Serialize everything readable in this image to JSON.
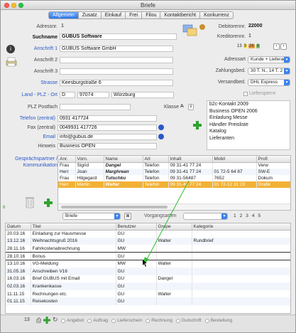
{
  "window": {
    "title": "Briefe"
  },
  "tabs": [
    "Allgemein",
    "Zusatz",
    "Einkauf",
    "Frei",
    "Filou",
    "Kontaktbericht",
    "Konkurrenz"
  ],
  "header": {
    "adressnr_label": "Adressnr.",
    "adressnr_value": "1",
    "suchname_label": "Suchname",
    "suchname_value": "GUBUS Software",
    "debitorennr_label": "Debitorennr.",
    "debitorennr_value": "22000",
    "kreditorennr_label": "Kreditorennr.",
    "kreditorennr_value": "1",
    "counters": [
      "13",
      "9",
      "26",
      "8"
    ]
  },
  "address": {
    "anschrift1_label": "Anschrift 1",
    "anschrift1_value": "GUBUS Software GmbH",
    "anschrift2_label": "Anschrift 2",
    "anschrift2_value": "",
    "anschrift3_label": "Anschrift 3",
    "anschrift3_value": "",
    "strasse_label": "Strasse",
    "strasse_value": "Keesburgstraße 6",
    "land_label": "Land - PLZ - Ort",
    "land_value": "D",
    "plz_value": "97074",
    "ort_value": "Würzburg",
    "postfach_label": "PLZ Postfach",
    "postfach_value": "",
    "klasse_label": "Klasse",
    "klasse_value": "A"
  },
  "right_fields": {
    "adressart_label": "Adressart",
    "adressart_value": "Kunde + Lieferant",
    "zahlung_label": "Zahlungsbed.",
    "zahlung_value": "30 T. N., 14 T. 2 %",
    "versand_label": "Versandbed.",
    "versand_value": "DHL Express",
    "liefersperre_label": "Liefersperre"
  },
  "mailing_list": [
    "b2c-Kontakt 2009",
    "Business OPEN 2006",
    "Einladung Messe",
    "Händler Preisliste",
    "Katalog",
    "Lieferanten"
  ],
  "contact": {
    "telefon_label": "Telefon (zentral)",
    "telefon_value": "0931 417724",
    "fax_label": "Fax (zentral)",
    "fax_value": "0049931 417726",
    "email_label": "Email",
    "email_value": "info@gubus.de",
    "hinweis_label": "Hinweis",
    "hinweis_value": "Business OPEN"
  },
  "partners": {
    "section_label": "Gesprächspartner / Kommunikation",
    "count": "6",
    "columns": [
      "Anr.",
      "Vorn.",
      "Name",
      "Art",
      "Inhalt",
      "Mobil",
      "Profi"
    ],
    "rows": [
      [
        "Frau",
        "Sigrid",
        "Dangel",
        "Telefon",
        "09 31-41 77 24",
        "",
        "Verw"
      ],
      [
        "Herr",
        "Joan",
        "Marghrean",
        "Telefon",
        "09 31-41 77 24",
        "01 72-5 64 87",
        "SW-E"
      ],
      [
        "Frau",
        "Hilgegard",
        "Tutschku",
        "Telefon",
        "09 31-56487",
        "7652",
        "Dokum"
      ],
      [
        "Herr",
        "Martin",
        "Walter",
        "Telefon",
        "09 31-41 77 24",
        "01 72-12 31 23",
        "Grafik"
      ]
    ],
    "pager": [
      "1",
      "2",
      "3",
      "4",
      "5"
    ]
  },
  "letters": {
    "filter_value": "Briefe",
    "vorgang_label": "Vorgangsarten",
    "columns": [
      "Datum",
      "Titel",
      "Benutzer",
      "Grupe",
      "Kategorie"
    ],
    "rows": [
      [
        "20.03.16",
        "Einladung zur Hausmesse",
        "GU",
        "",
        ""
      ],
      [
        "13.12.16",
        "Weihnachtsgruß 2016",
        "GU",
        "Walter",
        "Rundbrief"
      ],
      [
        "28.11.16",
        "Fahrkostenabrechnung",
        "MW",
        "",
        ""
      ],
      [
        "28.10.16",
        "Bonus",
        "GU",
        "",
        ""
      ],
      [
        "13.10.16",
        "VG-Meldung",
        "MW",
        "Walter",
        ""
      ],
      [
        "31.05.16",
        "Anschreiben V16",
        "GU",
        "",
        ""
      ],
      [
        "16.03.16",
        "Brief GUBUS mit Email",
        "GU",
        "Dangel",
        ""
      ],
      [
        "02.03.16",
        "Krankenkasse",
        "GU",
        "",
        ""
      ],
      [
        "11.11.15",
        "Rechnungen etc.",
        "GU",
        "Walter",
        ""
      ],
      [
        "01.11.15",
        "Reisekosten",
        "GU",
        "",
        ""
      ]
    ],
    "count": "13"
  },
  "footer": {
    "checks": [
      "Angebot",
      "Auftrag",
      "Lieferschein",
      "Rechnung",
      "Gutschrift",
      "Bestellung"
    ]
  },
  "colors": {
    "accent": "#2e76e6",
    "selected_row": "#f2b134",
    "link": "#2a58c9",
    "add": "#2fa22f"
  }
}
